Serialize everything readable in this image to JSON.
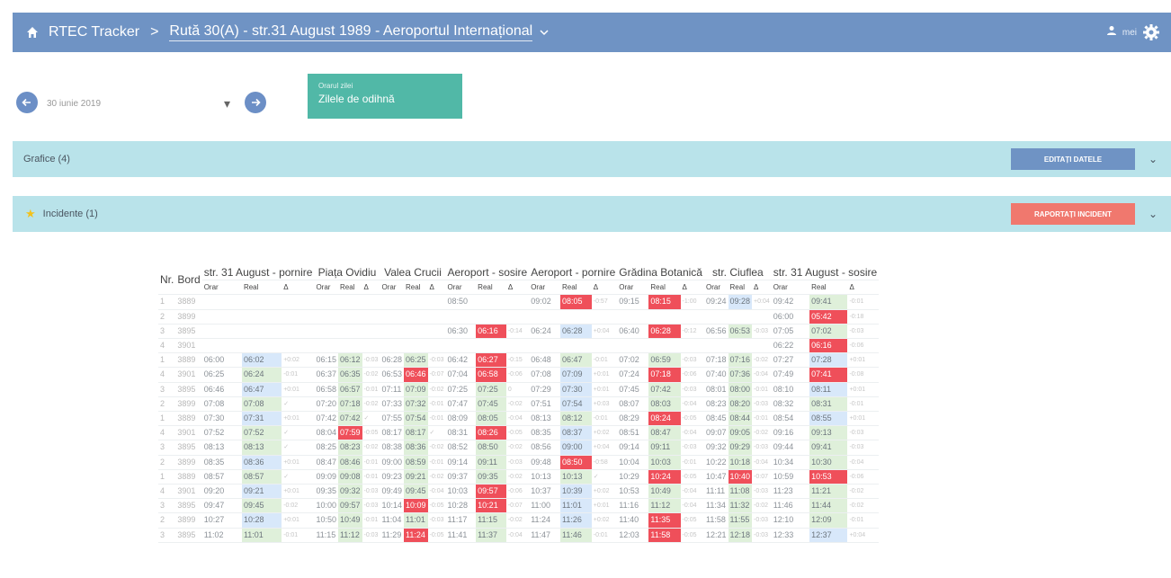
{
  "header": {
    "app_title": "RTEC Tracker",
    "separator": ">",
    "route_title": "Rută 30(A) - str.31 August 1989 - Aeroportul Internațional",
    "user_text": "mei"
  },
  "controls": {
    "date_value": "30 iunie 2019",
    "day_type_label": "Orarul zilei",
    "day_type_value": "Zilele de odihnă"
  },
  "panels": {
    "graphs": {
      "title": "Grafice (4)",
      "button": "Editați datele"
    },
    "incidents": {
      "title": "Incidente (1)",
      "button": "Raportați incident"
    }
  },
  "colors": {
    "appbar": "#6f93c4",
    "panel": "#b9e3ea",
    "daytype": "#51b8a7",
    "edit_btn": "#6f93c4",
    "report_btn": "#f0786e"
  },
  "table": {
    "nr_header": "Nr.",
    "bord_header": "Bord",
    "stops": [
      "str. 31 August - pornire",
      "Piața Ovidiu",
      "Valea Crucii",
      "Aeroport - sosire",
      "Aeroport - pornire",
      "Grădina Botanică",
      "str. Ciuflea",
      "str. 31 August - sosire"
    ],
    "sub_headers": [
      "Orar",
      "Real",
      "Δ"
    ],
    "rows": [
      {
        "nr": "1",
        "bord": "3889",
        "c": [
          "",
          "",
          "",
          "",
          "",
          "",
          "",
          "",
          "",
          "08:50",
          "",
          "",
          "09:02",
          "08:05",
          "-0:57",
          "09:15",
          "08:15",
          "-1:00",
          "09:24",
          "09:28",
          "+0:04",
          "09:42",
          "09:41",
          "-0:01"
        ]
      },
      {
        "nr": "2",
        "bord": "3899",
        "c": [
          "",
          "",
          "",
          "",
          "",
          "",
          "",
          "",
          "",
          "",
          "",
          "",
          "",
          "",
          "",
          "",
          "",
          "",
          "",
          "",
          "",
          "06:00",
          "05:42",
          "-0:18"
        ]
      },
      {
        "nr": "3",
        "bord": "3895",
        "c": [
          "",
          "",
          "",
          "",
          "",
          "",
          "",
          "",
          "",
          "06:30",
          "06:16",
          "-0:14",
          "06:24",
          "06:28",
          "+0:04",
          "06:40",
          "06:28",
          "-0:12",
          "06:56",
          "06:53",
          "-0:03",
          "07:05",
          "07:02",
          "-0:03"
        ]
      },
      {
        "nr": "4",
        "bord": "3901",
        "c": [
          "",
          "",
          "",
          "",
          "",
          "",
          "",
          "",
          "",
          "",
          "",
          "",
          "",
          "",
          "",
          "",
          "",
          "",
          "",
          "",
          "",
          "06:22",
          "06:16",
          "-0:06"
        ]
      },
      {
        "nr": "1",
        "bord": "3889",
        "c": [
          "06:00",
          "06:02",
          "+0:02",
          "06:15",
          "06:12",
          "-0:03",
          "06:28",
          "06:25",
          "-0:03",
          "06:42",
          "06:27",
          "-0:15",
          "06:48",
          "06:47",
          "-0:01",
          "07:02",
          "06:59",
          "-0:03",
          "07:18",
          "07:16",
          "-0:02",
          "07:27",
          "07:28",
          "+0:01"
        ]
      },
      {
        "nr": "4",
        "bord": "3901",
        "c": [
          "06:25",
          "06:24",
          "-0:01",
          "06:37",
          "06:35",
          "-0:02",
          "06:53",
          "06:46",
          "-0:07",
          "07:04",
          "06:58",
          "-0:06",
          "07:08",
          "07:09",
          "+0:01",
          "07:24",
          "07:18",
          "-0:06",
          "07:40",
          "07:36",
          "-0:04",
          "07:49",
          "07:41",
          "-0:08"
        ]
      },
      {
        "nr": "3",
        "bord": "3895",
        "c": [
          "06:46",
          "06:47",
          "+0:01",
          "06:58",
          "06:57",
          "-0:01",
          "07:11",
          "07:09",
          "-0:02",
          "07:25",
          "07:25",
          "0",
          "07:29",
          "07:30",
          "+0:01",
          "07:45",
          "07:42",
          "-0:03",
          "08:01",
          "08:00",
          "-0:01",
          "08:10",
          "08:11",
          "+0:01"
        ]
      },
      {
        "nr": "2",
        "bord": "3899",
        "c": [
          "07:08",
          "07:08",
          "✓",
          "07:20",
          "07:18",
          "-0:02",
          "07:33",
          "07:32",
          "-0:01",
          "07:47",
          "07:45",
          "-0:02",
          "07:51",
          "07:54",
          "+0:03",
          "08:07",
          "08:03",
          "-0:04",
          "08:23",
          "08:20",
          "-0:03",
          "08:32",
          "08:31",
          "-0:01"
        ]
      },
      {
        "nr": "1",
        "bord": "3889",
        "c": [
          "07:30",
          "07:31",
          "+0:01",
          "07:42",
          "07:42",
          "✓",
          "07:55",
          "07:54",
          "-0:01",
          "08:09",
          "08:05",
          "-0:04",
          "08:13",
          "08:12",
          "-0:01",
          "08:29",
          "08:24",
          "-0:05",
          "08:45",
          "08:44",
          "-0:01",
          "08:54",
          "08:55",
          "+0:01"
        ]
      },
      {
        "nr": "4",
        "bord": "3901",
        "c": [
          "07:52",
          "07:52",
          "✓",
          "08:04",
          "07:59",
          "-0:05",
          "08:17",
          "08:17",
          "✓",
          "08:31",
          "08:26",
          "-0:05",
          "08:35",
          "08:37",
          "+0:02",
          "08:51",
          "08:47",
          "-0:04",
          "09:07",
          "09:05",
          "-0:02",
          "09:16",
          "09:13",
          "-0:03"
        ]
      },
      {
        "nr": "3",
        "bord": "3895",
        "c": [
          "08:13",
          "08:13",
          "✓",
          "08:25",
          "08:23",
          "-0:02",
          "08:38",
          "08:36",
          "-0:02",
          "08:52",
          "08:50",
          "-0:02",
          "08:56",
          "09:00",
          "+0:04",
          "09:14",
          "09:11",
          "-0:03",
          "09:32",
          "09:29",
          "-0:03",
          "09:44",
          "09:41",
          "-0:03"
        ]
      },
      {
        "nr": "2",
        "bord": "3899",
        "c": [
          "08:35",
          "08:36",
          "+0:01",
          "08:47",
          "08:46",
          "-0:01",
          "09:00",
          "08:59",
          "-0:01",
          "09:14",
          "09:11",
          "-0:03",
          "09:48",
          "08:50",
          "-0:58",
          "10:04",
          "10:03",
          "-0:01",
          "10:22",
          "10:18",
          "-0:04",
          "10:34",
          "10:30",
          "-0:04"
        ]
      },
      {
        "nr": "1",
        "bord": "3889",
        "c": [
          "08:57",
          "08:57",
          "✓",
          "09:09",
          "09:08",
          "-0:01",
          "09:23",
          "09:21",
          "-0:02",
          "09:37",
          "09:35",
          "-0:02",
          "10:13",
          "10:13",
          "✓",
          "10:29",
          "10:24",
          "-0:05",
          "10:47",
          "10:40",
          "-0:07",
          "10:59",
          "10:53",
          "-0:06"
        ]
      },
      {
        "nr": "4",
        "bord": "3901",
        "c": [
          "09:20",
          "09:21",
          "+0:01",
          "09:35",
          "09:32",
          "-0:03",
          "09:49",
          "09:45",
          "-0:04",
          "10:03",
          "09:57",
          "-0:06",
          "10:37",
          "10:39",
          "+0:02",
          "10:53",
          "10:49",
          "-0:04",
          "11:11",
          "11:08",
          "-0:03",
          "11:23",
          "11:21",
          "-0:02"
        ]
      },
      {
        "nr": "3",
        "bord": "3895",
        "c": [
          "09:47",
          "09:45",
          "-0:02",
          "10:00",
          "09:57",
          "-0:03",
          "10:14",
          "10:09",
          "-0:05",
          "10:28",
          "10:21",
          "-0:07",
          "11:00",
          "11:01",
          "+0:01",
          "11:16",
          "11:12",
          "-0:04",
          "11:34",
          "11:32",
          "-0:02",
          "11:46",
          "11:44",
          "-0:02"
        ]
      },
      {
        "nr": "2",
        "bord": "3899",
        "c": [
          "10:27",
          "10:28",
          "+0:01",
          "10:50",
          "10:49",
          "-0:01",
          "11:04",
          "11:01",
          "-0:03",
          "11:17",
          "11:15",
          "-0:02",
          "11:24",
          "11:26",
          "+0:02",
          "11:40",
          "11:35",
          "-0:05",
          "11:58",
          "11:55",
          "-0:03",
          "12:10",
          "12:09",
          "-0:01"
        ]
      },
      {
        "nr": "3",
        "bord": "3895",
        "c": [
          "11:02",
          "11:01",
          "-0:01",
          "11:15",
          "11:12",
          "-0:03",
          "11:29",
          "11:24",
          "-0:05",
          "11:41",
          "11:37",
          "-0:04",
          "11:47",
          "11:46",
          "-0:01",
          "12:03",
          "11:58",
          "-0:05",
          "12:21",
          "12:18",
          "-0:03",
          "12:33",
          "12:37",
          "+0:04"
        ]
      }
    ]
  }
}
